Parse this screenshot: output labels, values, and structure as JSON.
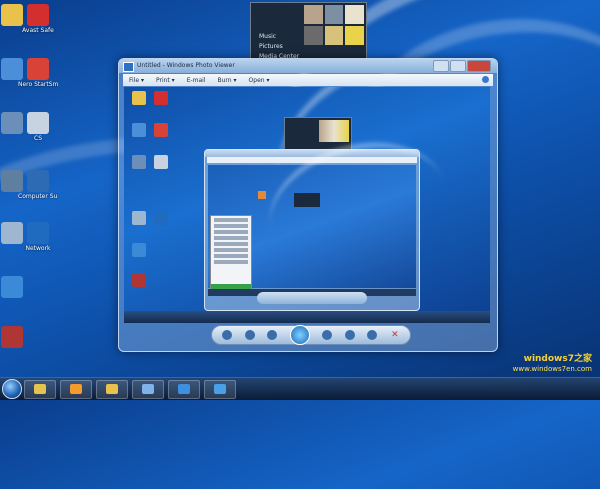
{
  "desktop": {
    "icons": [
      {
        "label": "",
        "icon": "folder-icon",
        "color": "#e8c24a"
      },
      {
        "label": "Avast Safe",
        "icon": "avast-icon",
        "color": "#d32f2f"
      },
      {
        "label": "",
        "icon": "network-icon",
        "color": "#4a8fd8"
      },
      {
        "label": "Nero StartSmart",
        "icon": "nero-icon",
        "color": "#d94236"
      },
      {
        "label": "",
        "icon": "control-icon",
        "color": "#6b8fb8"
      },
      {
        "label": "CS",
        "icon": "game-icon",
        "color": "#c7d3e0"
      },
      {
        "label": "",
        "icon": "app-icon",
        "color": "#5f7fa0"
      },
      {
        "label": "Computer Supplies",
        "icon": "computer-icon",
        "color": "#2e6bb5"
      },
      {
        "label": "",
        "icon": "recycle-bin-icon",
        "color": "#9eb6cf"
      },
      {
        "label": "Network",
        "icon": "network-icon",
        "color": "#1f6bc0"
      },
      {
        "label": "",
        "icon": "app-icon",
        "color": "#3b8ad8"
      },
      {
        "label": "",
        "icon": "app-icon",
        "color": "#b03535"
      }
    ]
  },
  "mosaic": {
    "labels": [
      "Music",
      "Pictures",
      "Media Center"
    ],
    "tile_colors": [
      "#b8a48c",
      "#7c8fa3",
      "#e9e2cf",
      "#6b6b6b",
      "#d8c17a",
      "#e8d34a"
    ]
  },
  "window": {
    "title": "Untitled - Windows Photo Viewer",
    "menu": [
      "File ▾",
      "Print ▾",
      "E-mail",
      "Burn ▾",
      "Open ▾"
    ],
    "help": "?"
  },
  "taskbar": {
    "buttons": [
      {
        "icon": "explorer-icon",
        "color": "#e6c24f"
      },
      {
        "icon": "media-player-icon",
        "color": "#f39b2d"
      },
      {
        "icon": "folder-icon",
        "color": "#e8c24a"
      },
      {
        "icon": "network-icon",
        "color": "#7fb2e8"
      },
      {
        "icon": "ie-icon",
        "color": "#3e8fe0"
      },
      {
        "icon": "photo-viewer-icon",
        "color": "#4aa0e6"
      }
    ]
  },
  "watermark": {
    "line1": "windows7之家",
    "line2": "www.windows7en.com"
  }
}
